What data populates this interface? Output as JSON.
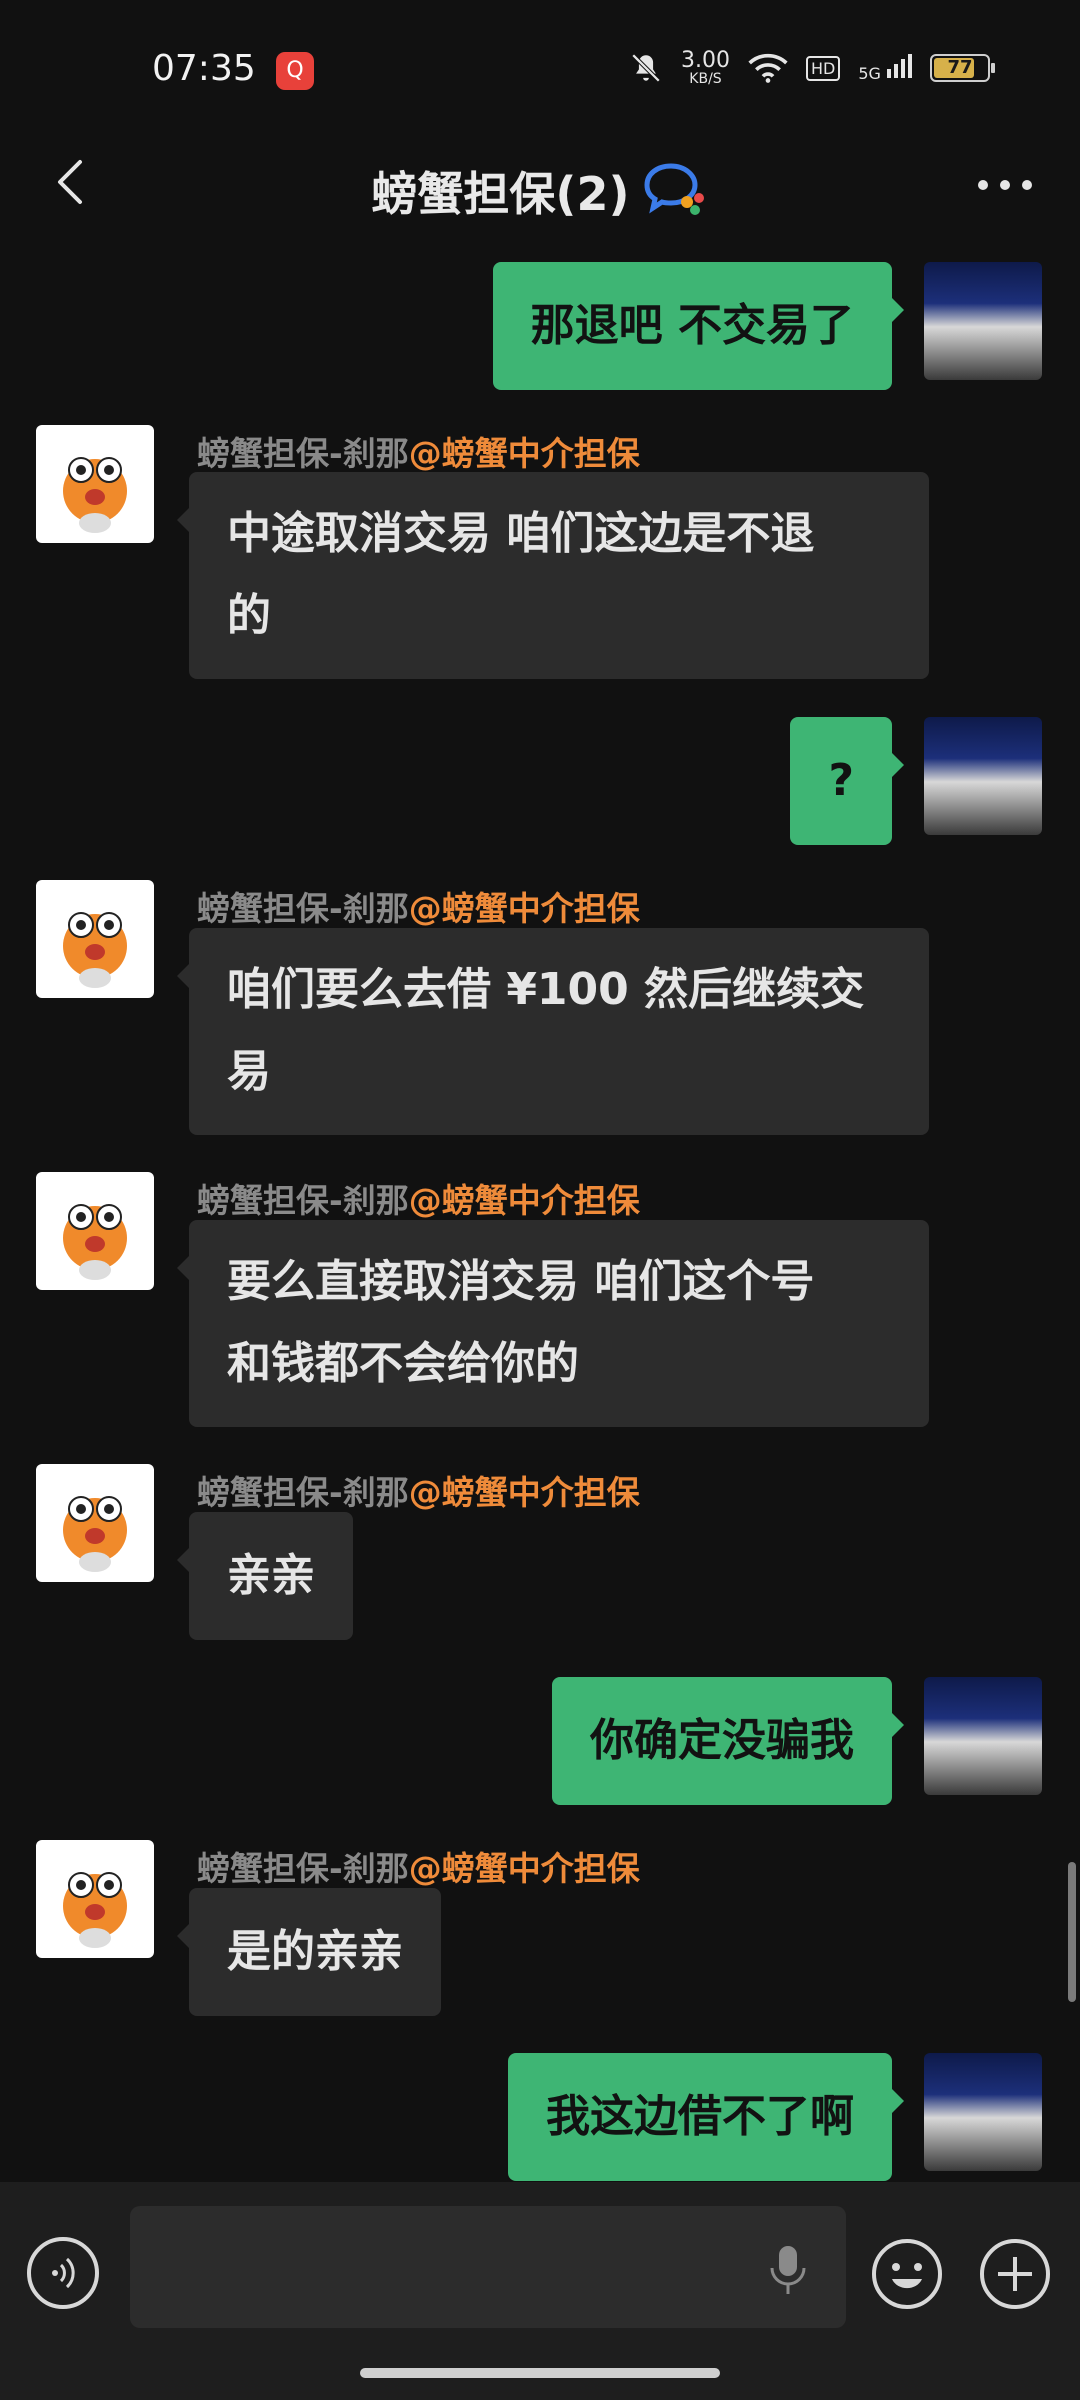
{
  "status_bar": {
    "time": "07:35",
    "app_badge": "Q",
    "net_speed_value": "3.00",
    "net_speed_unit": "KB/S",
    "hd_label": "HD",
    "signal_label": "5G",
    "battery_level": "77",
    "battery_fraction": 0.77
  },
  "header": {
    "title": "螃蟹担保(2)"
  },
  "messages": [
    {
      "side": "out",
      "text": "那退吧 不交易了"
    },
    {
      "side": "in",
      "sender": "螃蟹担保-刹那",
      "tag": "@螃蟹中介担保",
      "text_lines": [
        "中途取消交易 咱们这边是不退",
        "的"
      ]
    },
    {
      "side": "out",
      "text": "?"
    },
    {
      "side": "in",
      "sender": "螃蟹担保-刹那",
      "tag": "@螃蟹中介担保",
      "text_lines": [
        "咱们要么去借 ¥100 然后继续交",
        "易"
      ]
    },
    {
      "side": "in",
      "sender": "螃蟹担保-刹那",
      "tag": "@螃蟹中介担保",
      "text_lines": [
        "要么直接取消交易 咱们这个号",
        "和钱都不会给你的"
      ]
    },
    {
      "side": "in",
      "sender": "螃蟹担保-刹那",
      "tag": "@螃蟹中介担保",
      "text": "亲亲"
    },
    {
      "side": "out",
      "text": "你确定没骗我"
    },
    {
      "side": "in",
      "sender": "螃蟹担保-刹那",
      "tag": "@螃蟹中介担保",
      "text": "是的亲亲"
    },
    {
      "side": "out",
      "text": "我这边借不了啊"
    }
  ],
  "input_bar": {
    "placeholder": ""
  },
  "icons": {
    "back": "chevron-left-icon",
    "chat": "chat-bubble-icon",
    "more": "more-dots-icon",
    "voice": "voice-icon",
    "mic": "microphone-icon",
    "emoji": "emoji-icon",
    "plus": "plus-icon",
    "mute": "bell-off-icon",
    "wifi": "wifi-icon"
  },
  "colors": {
    "outgoing_bubble": "#3eb574",
    "incoming_bubble": "#2c2c2c",
    "sender_tag": "#ef8b3a"
  }
}
